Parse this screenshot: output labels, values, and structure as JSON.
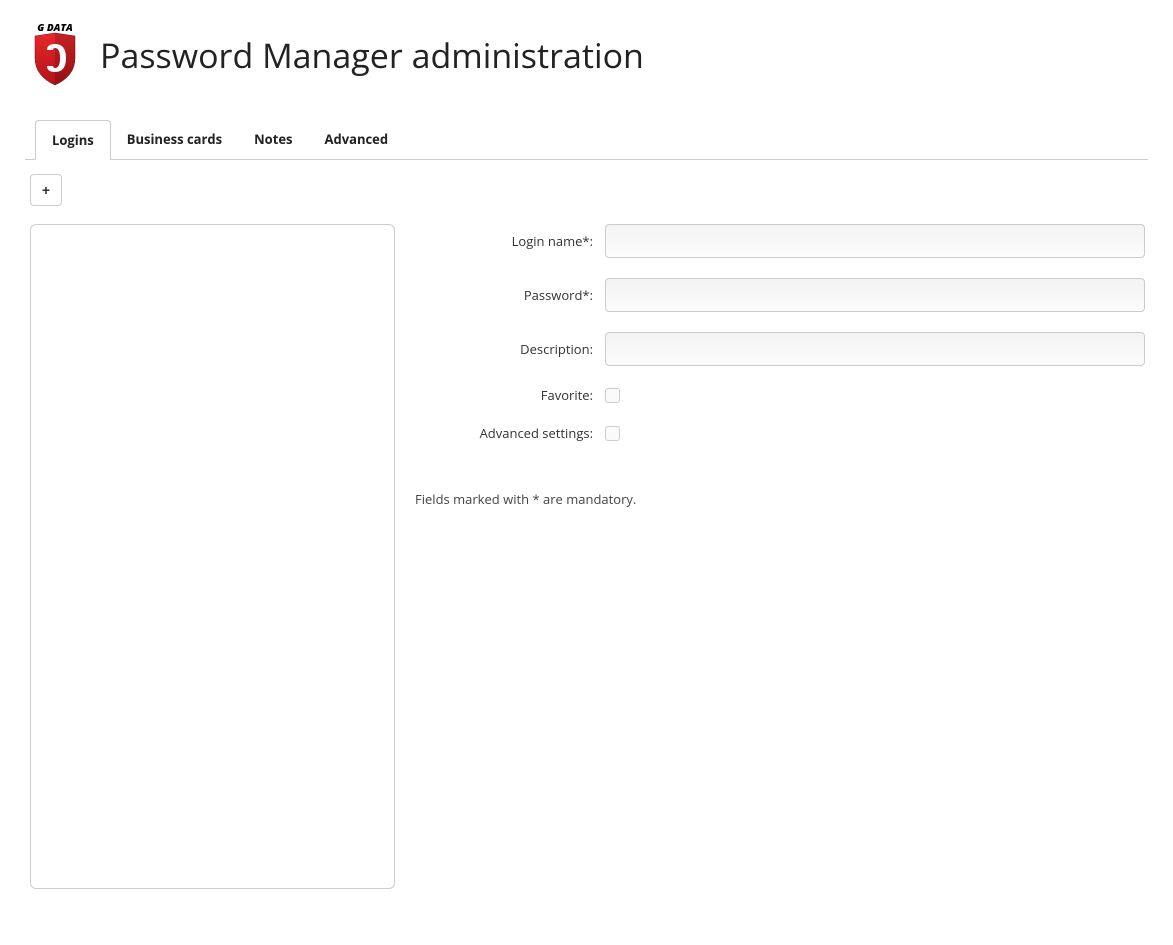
{
  "header": {
    "logo_text": "G DATA",
    "title": "Password Manager administration"
  },
  "tabs": {
    "items": [
      {
        "label": "Logins",
        "active": true
      },
      {
        "label": "Business cards",
        "active": false
      },
      {
        "label": "Notes",
        "active": false
      },
      {
        "label": "Advanced",
        "active": false
      }
    ]
  },
  "toolbar": {
    "add_label": "+"
  },
  "form": {
    "login_name_label": "Login name*:",
    "login_name_value": "",
    "password_label": "Password*:",
    "password_value": "",
    "description_label": "Description:",
    "description_value": "",
    "favorite_label": "Favorite:",
    "favorite_checked": false,
    "advanced_label": "Advanced settings:",
    "advanced_checked": false,
    "mandatory_note": "Fields marked with * are mandatory."
  }
}
